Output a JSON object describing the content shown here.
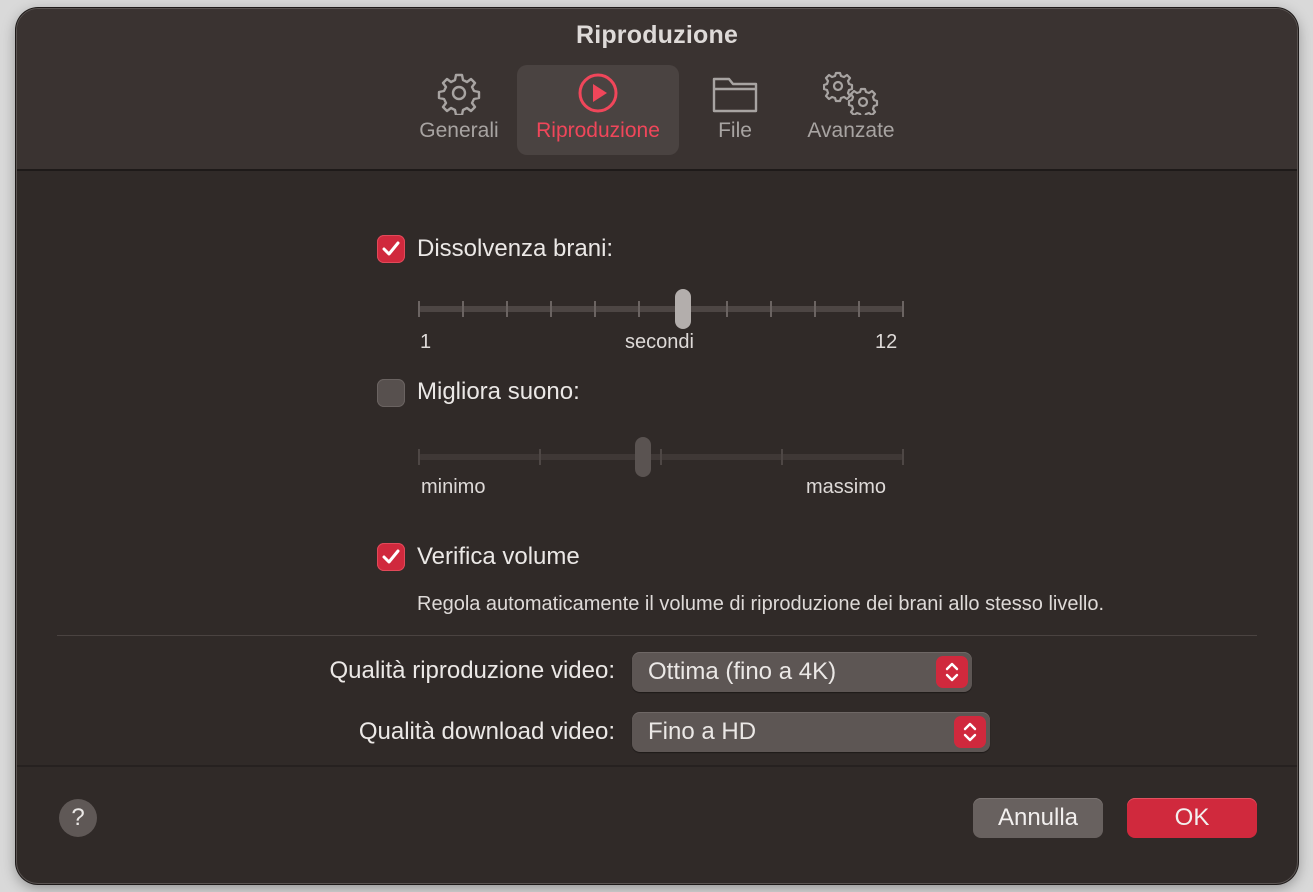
{
  "window": {
    "title": "Riproduzione"
  },
  "tabs": [
    {
      "label": "Generali",
      "icon": "gear-icon",
      "active": false
    },
    {
      "label": "Riproduzione",
      "icon": "play-circle-icon",
      "active": true
    },
    {
      "label": "File",
      "icon": "folder-icon",
      "active": false
    },
    {
      "label": "Avanzate",
      "icon": "double-gear-icon",
      "active": false
    }
  ],
  "crossfade": {
    "label": "Dissolvenza brani:",
    "checked": true,
    "slider": {
      "min_label": "1",
      "center_label": "secondi",
      "max_label": "12",
      "min": 1,
      "max": 12,
      "value": 7
    }
  },
  "sound_enhancer": {
    "label": "Migliora suono:",
    "checked": false,
    "slider": {
      "min_label": "minimo",
      "max_label": "massimo",
      "fraction": 0.5
    }
  },
  "sound_check": {
    "label": "Verifica volume",
    "checked": true,
    "description": "Regola automaticamente il volume di riproduzione dei brani allo stesso livello."
  },
  "video_playback": {
    "label": "Qualità riproduzione video:",
    "value": "Ottima (fino a 4K)"
  },
  "video_download": {
    "label": "Qualità download video:",
    "value": "Fino a HD"
  },
  "footer": {
    "help_label": "?",
    "cancel_label": "Annulla",
    "ok_label": "OK"
  },
  "colors": {
    "accent": "#d0293d",
    "active_tab_text": "#f0465a",
    "window_bg": "#302a28",
    "toolbar_bg": "#3a3331"
  }
}
